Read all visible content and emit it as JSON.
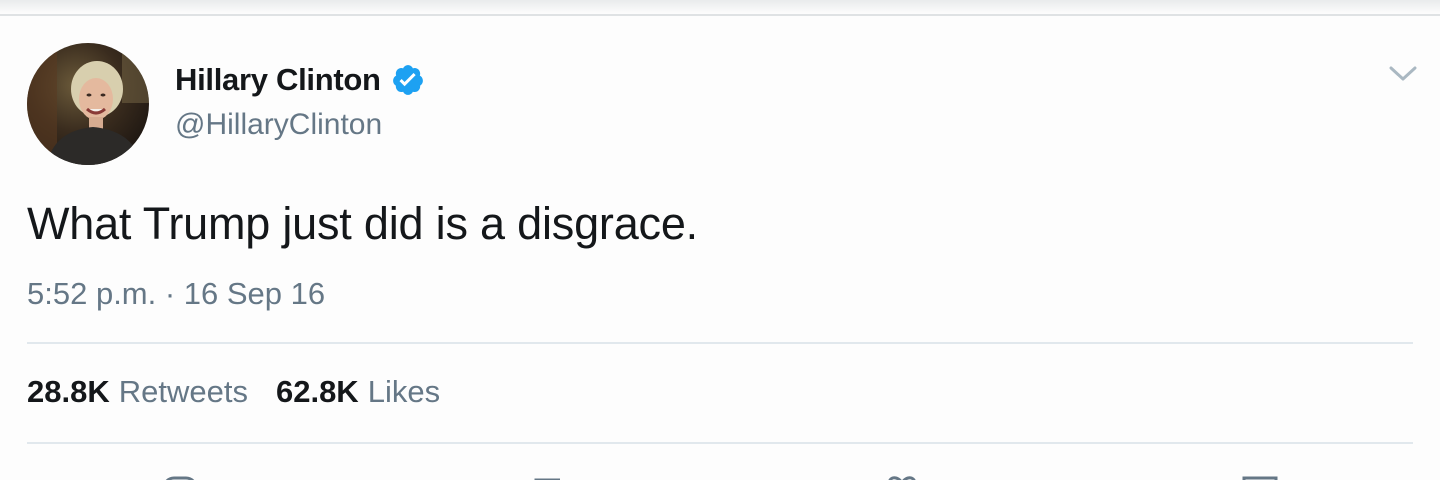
{
  "tweet": {
    "author": {
      "display_name": "Hillary Clinton",
      "handle": "@HillaryClinton",
      "verified": true,
      "avatar_icon": "profile-photo"
    },
    "text": "What Trump just did is a disgrace.",
    "timestamp": "5:52 p.m. · 16 Sep 16",
    "stats": {
      "retweets_count": "28.8K",
      "retweets_label": "Retweets",
      "likes_count": "62.8K",
      "likes_label": "Likes"
    },
    "actions": [
      "reply-icon",
      "retweet-icon",
      "like-icon",
      "share-icon"
    ]
  },
  "colors": {
    "verified_blue": "#1da1f2",
    "text_primary": "#14171a",
    "text_secondary": "#657786",
    "divider": "#e1e8ed"
  }
}
